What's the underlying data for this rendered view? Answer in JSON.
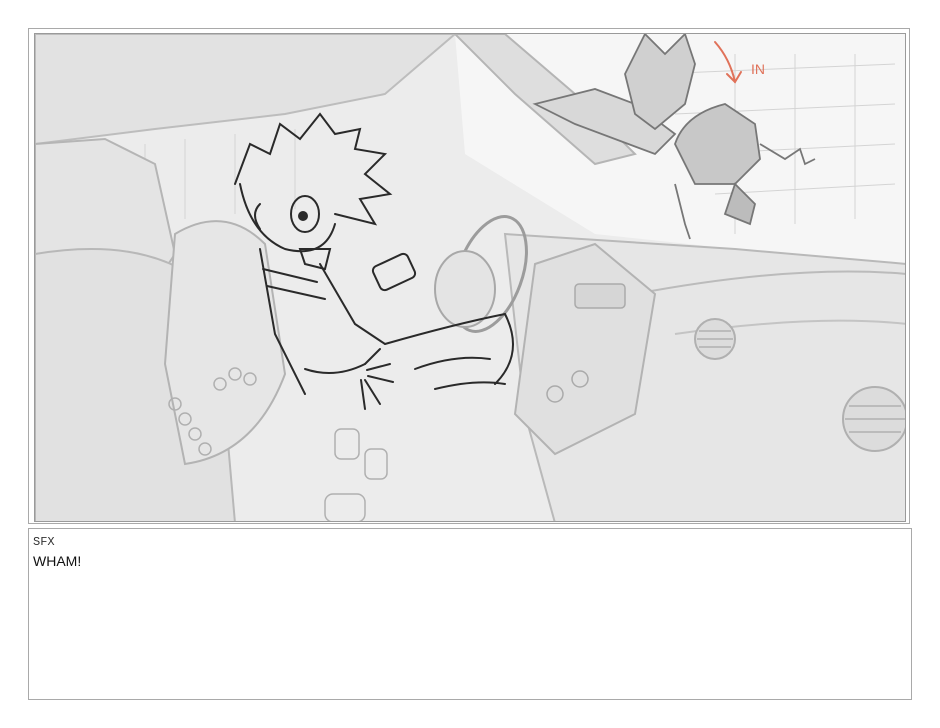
{
  "panel": {
    "image_desc_icon": "storyboard-sketch",
    "annotation": "IN",
    "annotation_color": "#e0725a"
  },
  "caption": {
    "label": "SFX",
    "text": "WHAM!"
  }
}
